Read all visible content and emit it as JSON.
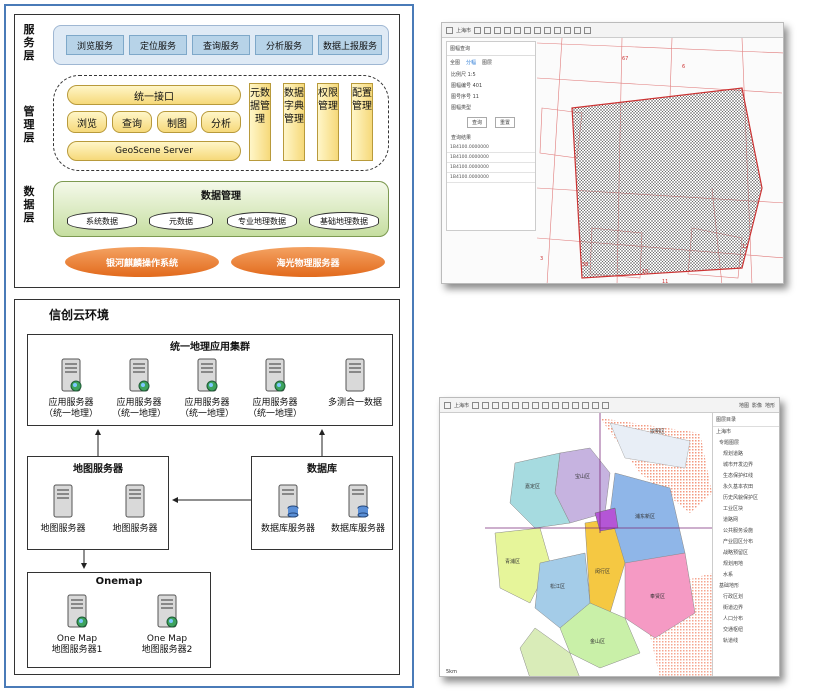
{
  "architecture": {
    "layers": {
      "service": "服务层",
      "management": "管理层",
      "data": "数据层"
    },
    "service_buttons": [
      "浏览服务",
      "定位服务",
      "查询服务",
      "分析服务",
      "数据上报服务"
    ],
    "management": {
      "unified_interface": "统一接口",
      "functions": [
        "浏览",
        "查询",
        "制图",
        "分析"
      ],
      "server": "GeoScene Server",
      "vertical_modules": [
        "元数据管理",
        "数据字典管理",
        "权限管理",
        "配置管理"
      ]
    },
    "data_layer": {
      "title": "数据管理",
      "databases": [
        "系统数据",
        "元数据",
        "专业地理数据",
        "基础地理数据"
      ]
    },
    "foundation": [
      "银河麒麟操作系统",
      "海光物理服务器"
    ]
  },
  "cloud": {
    "title": "信创云环境",
    "app_cluster": {
      "title": "统一地理应用集群",
      "servers": [
        "应用服务器\n（统一地理）",
        "应用服务器\n（统一地理）",
        "应用服务器\n（统一地理）",
        "应用服务器\n（统一地理）",
        "多测合一数据"
      ]
    },
    "map_servers": {
      "title": "地图服务器",
      "servers": [
        "地图服务器",
        "地图服务器"
      ]
    },
    "database": {
      "title": "数据库",
      "servers": [
        "数据库服务器",
        "数据库服务器"
      ]
    },
    "onemap": {
      "title": "Onemap",
      "servers": [
        "One Map\n地图服务器1",
        "One Map\n地图服务器2"
      ]
    }
  },
  "screenshot_top": {
    "toolbar": "上海市",
    "panel_title": "图幅查询",
    "tabs": [
      "全图",
      "分幅",
      "图层"
    ],
    "fields": [
      "比例尺 1:5",
      "图幅编号 401",
      "图号序号 11",
      "图幅类型"
    ],
    "buttons": [
      "查询",
      "重置"
    ],
    "list_header": "查询结果",
    "list_rows": [
      "1B4100.0000000",
      "1B4100.0000000",
      "1B4100.0000000",
      "1B4100.0000000"
    ],
    "map_numbers": [
      "67",
      "6",
      "12",
      "10",
      "38",
      "11",
      "3"
    ]
  },
  "screenshot_bottom": {
    "toolbar": "上海市",
    "tabs": [
      "地图",
      "影像",
      "地形"
    ],
    "panel_title": "图层目录",
    "tree_items": [
      "上海市",
      "专题图层",
      "规划道路",
      "城市开发边界",
      "生态保护红线",
      "永久基本农田",
      "历史风貌保护区",
      "工业区块",
      "道路网",
      "公共服务设施",
      "产业园区分布",
      "战略预留区",
      "规划用地",
      "水系",
      "基础地形",
      "行政区划",
      "街道边界",
      "人口分布",
      "交通枢纽",
      "轨道线"
    ],
    "districts": [
      "崇明区",
      "宝山区",
      "嘉定区",
      "青浦区",
      "松江区",
      "闵行区",
      "浦东新区",
      "奉贤区",
      "金山区"
    ],
    "scale": "5km"
  }
}
